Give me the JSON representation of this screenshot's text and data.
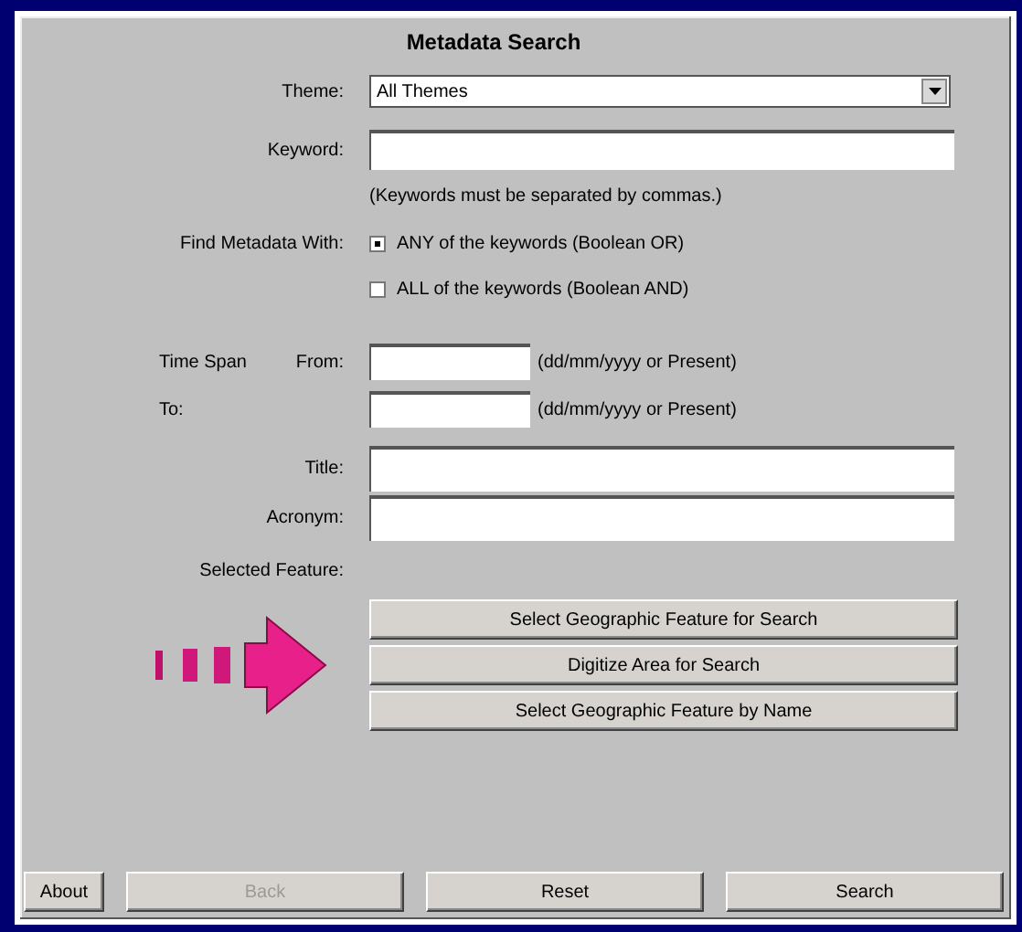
{
  "title": "Metadata Search",
  "theme": {
    "label": "Theme:",
    "value": "All Themes"
  },
  "keyword": {
    "label": "Keyword:",
    "hint": "(Keywords must be separated by commas.)"
  },
  "find_with": {
    "label": "Find Metadata With:",
    "options": [
      {
        "label": "ANY of the keywords (Boolean OR)",
        "selected": true
      },
      {
        "label": "ALL of the keywords (Boolean AND)",
        "selected": false
      }
    ]
  },
  "time_span": {
    "label": "Time Span",
    "rows": [
      {
        "label": "From:",
        "hint": "(dd/mm/yyyy or Present)"
      },
      {
        "label": "To:",
        "hint": "(dd/mm/yyyy or Present)"
      }
    ]
  },
  "title_field": {
    "label": "Title:"
  },
  "acronym_field": {
    "label": "Acronym:"
  },
  "selected_feature": {
    "label": "Selected Feature:",
    "buttons": [
      "Select Geographic Feature for Search",
      "Digitize Area for Search",
      "Select Geographic Feature by Name"
    ]
  },
  "footer_buttons": [
    {
      "label": "About",
      "disabled": false
    },
    {
      "label": "Back",
      "disabled": true
    },
    {
      "label": "Reset",
      "disabled": false
    },
    {
      "label": "Search",
      "disabled": false
    }
  ]
}
